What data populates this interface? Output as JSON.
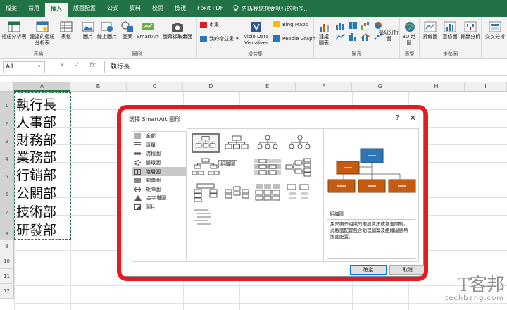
{
  "ribbon": {
    "tabs": [
      "檔案",
      "常用",
      "插入",
      "版面配置",
      "公式",
      "資料",
      "校閱",
      "檢視",
      "Foxit PDF"
    ],
    "active_tab": "插入",
    "tell_me": "告訴我您想要執行的動作...",
    "groups": {
      "tables": {
        "label": "表格",
        "pivot": "樞紐分析表",
        "recommended_pivot": "建議的樞紐分析表",
        "table": "表格"
      },
      "illustrations": {
        "label": "圖例",
        "pictures": "圖片",
        "online_pictures": "線上圖片",
        "shapes": "圖案",
        "smartart": "SmartArt",
        "screenshot": "螢幕擷取畫面"
      },
      "addins": {
        "label": "增益集",
        "store": "市集",
        "my_addins": "我的增益集",
        "visio1": "Visio Data",
        "visio2": "Visualizer",
        "bing": "Bing Maps",
        "people": "People Graph"
      },
      "charts": {
        "label": "圖表",
        "recommended": "建議圖表",
        "pivot_chart": "樞紐分析圖"
      },
      "tours": {
        "label": "導覽",
        "map3d": "3D 地圖"
      },
      "sparklines": {
        "label": "走勢圖",
        "line": "折線圖",
        "column": "直條圖",
        "winloss": "輸贏分析"
      },
      "filters": {
        "slicer": "交叉分析"
      }
    }
  },
  "formula_bar": {
    "name_box": "A1",
    "content": "執行長"
  },
  "sheet": {
    "columns": [
      "A",
      "B",
      "C",
      "D",
      "E",
      "F",
      "G",
      "H",
      "I"
    ],
    "rows": [
      "1",
      "2",
      "3",
      "4",
      "5",
      "6",
      "7",
      "8",
      "9",
      "10",
      "11",
      "12"
    ],
    "cells": [
      "執行長",
      "人事部",
      "財務部",
      "業務部",
      "行銷部",
      "公關部",
      "技術部",
      "研發部"
    ]
  },
  "dialog": {
    "title": "選擇 SmartArt 圖形",
    "help": "?",
    "close": "✕",
    "categories": [
      "全部",
      "清單",
      "流程圖",
      "循環圖",
      "階層圖",
      "關聯圖",
      "矩陣圖",
      "金字塔圖",
      "圖片"
    ],
    "selected_category": "階層圖",
    "gallery_tooltip": "組織圖",
    "preview_name": "組織圖",
    "preview_desc": "用來顯示組織的階層資訊或報告關聯。此版面配置包含助理圖案及組織圖懸吊版面配置。",
    "ok": "確定",
    "cancel": "取消"
  },
  "watermark": {
    "logo": "T客邦",
    "url": "techbang.com"
  },
  "colors": {
    "excel_green": "#217346",
    "highlight_red": "#e31b23",
    "preview_blue": "#2e75b6",
    "preview_orange": "#c55a11"
  }
}
